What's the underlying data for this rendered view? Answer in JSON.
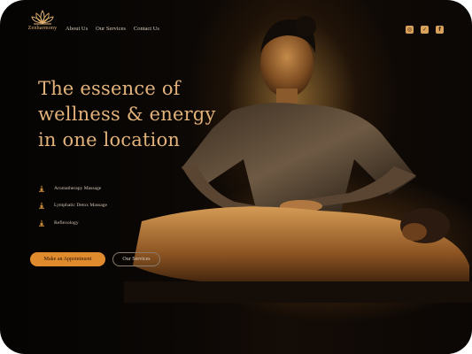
{
  "brand": {
    "name": "Zenharmony",
    "accent": "#e08a2e",
    "gold": "#e3b27a"
  },
  "nav": {
    "links": [
      {
        "label": "About Us"
      },
      {
        "label": "Our Services"
      },
      {
        "label": "Contact Us"
      }
    ],
    "social": [
      {
        "icon": "instagram-icon"
      },
      {
        "icon": "twitter-icon"
      },
      {
        "icon": "facebook-icon"
      }
    ]
  },
  "hero": {
    "headline_lines": [
      "The essence of",
      "wellness & energy",
      "in one location"
    ],
    "features": [
      {
        "label": "Aromatherapy Massage",
        "icon": "candle-icon"
      },
      {
        "label": "Lymphatic Detox Massage",
        "icon": "candle-icon"
      },
      {
        "label": "Reflexology",
        "icon": "candle-icon"
      }
    ],
    "primary_cta": "Make an Appointment",
    "secondary_cta": "Our Services"
  }
}
